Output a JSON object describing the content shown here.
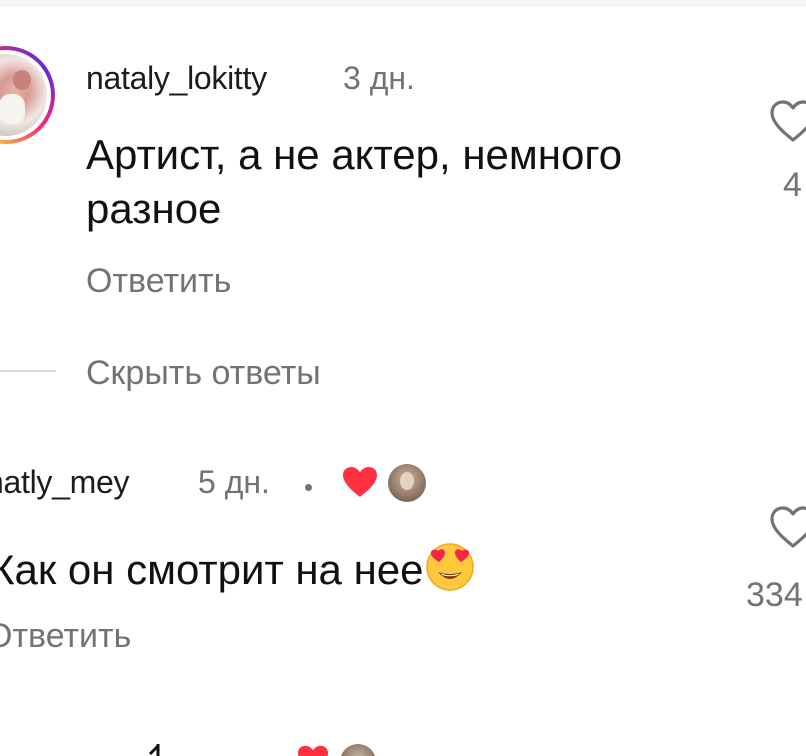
{
  "comments": [
    {
      "username": "nataly_lokitty",
      "time": "3 дн.",
      "text": "Артист, а не актер, немного разное",
      "reply_label": "Ответить",
      "like_count": "4"
    },
    {
      "username": "natly_mey",
      "time": "5 дн.",
      "text": "Как он смотрит на нее",
      "text_emoji": "smiling-face-with-heart-eyes",
      "reply_label": "Ответить",
      "like_count": "334",
      "author_liked": true
    }
  ],
  "thread": {
    "hide_replies_label": "Скрыть ответы"
  },
  "colors": {
    "primary_text": "#111111",
    "secondary_text": "#737373",
    "heart_red": "#ff3040",
    "divider": "#dbdbdb"
  },
  "icons": {
    "like": "heart-outline-icon",
    "author_like": "heart-filled-icon",
    "emoji": "heart-eyes-emoji-icon"
  }
}
